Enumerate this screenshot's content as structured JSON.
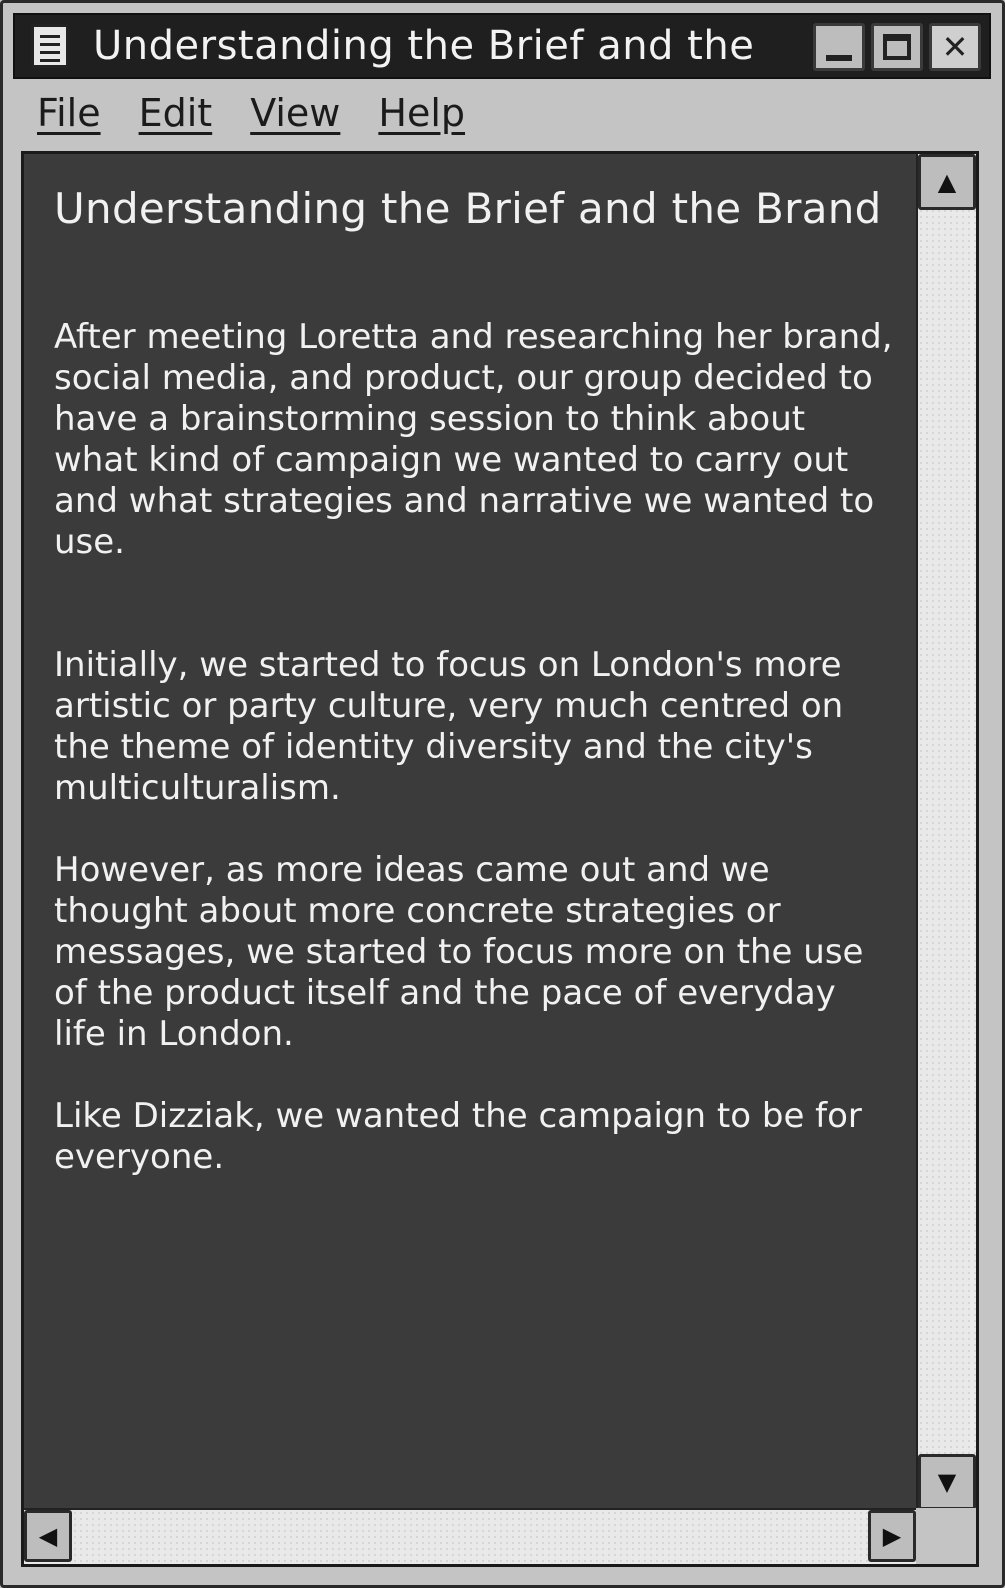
{
  "window": {
    "title": "Understanding the Brief and the ..."
  },
  "menu": {
    "file": "File",
    "edit": "Edit",
    "view": "View",
    "help": "Help"
  },
  "document": {
    "heading": "Understanding the Brief and the Brand",
    "paragraphs": [
      "After meeting Loretta and researching her brand, social media, and product, our group decided to have a brainstorming session to think about what kind of campaign we wanted to carry out and what strategies and narrative we wanted to use.",
      "Initially, we started to focus on London's more artistic or party culture, very much centred on the theme of identity diversity and the city's multiculturalism.",
      "However, as more ideas came out and we thought about more concrete strategies or messages, we started to focus more on the use of the product itself and the pace of everyday life in London.",
      "Like Dizziak, we wanted the campaign to be for everyone."
    ]
  },
  "icons": {
    "app": "notepad-icon",
    "minimize": "minimize-icon",
    "maximize": "maximize-icon",
    "close": "close-icon",
    "scroll_up": "arrow-up-icon",
    "scroll_down": "arrow-down-icon",
    "scroll_left": "arrow-left-icon",
    "scroll_right": "arrow-right-icon"
  },
  "colors": {
    "titlebar": "#1f1f1f",
    "document_bg": "#3b3b3c",
    "document_text": "#f1f1f1",
    "chrome": "#c4c4c4"
  }
}
